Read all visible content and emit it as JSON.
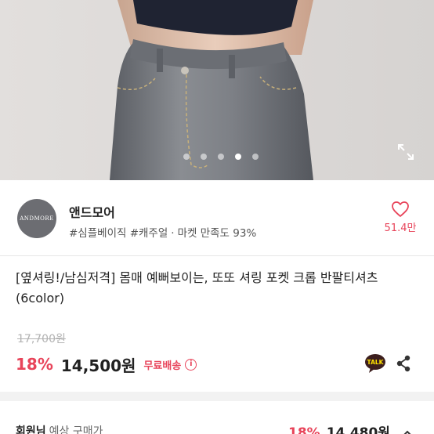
{
  "carousel": {
    "slide_count": 5,
    "active_index": 3
  },
  "store": {
    "avatar_text": "ANDMORE",
    "name": "앤드모어",
    "tags": "#심플베이직 #캐주얼",
    "separator": "·",
    "satisfaction": "마켓 만족도 93%",
    "like_count": "51.4만"
  },
  "product": {
    "title": "[옆셔링!/남심저격] 몸매 예뻐보이는, 또또 셔링 포켓 크롭 반팔티셔츠 (6color)",
    "original_price": "17,700원",
    "discount": "18%",
    "price": "14,500원",
    "shipping": "무료배송",
    "talk_label": "TALK"
  },
  "member": {
    "label": "회원님",
    "sub_label": "예상 구매가",
    "discount": "18%",
    "price": "14,480원"
  },
  "colors": {
    "accent": "#e8445a",
    "kakao": "#3c1e1e",
    "avatar_bg": "#6c6d72"
  }
}
